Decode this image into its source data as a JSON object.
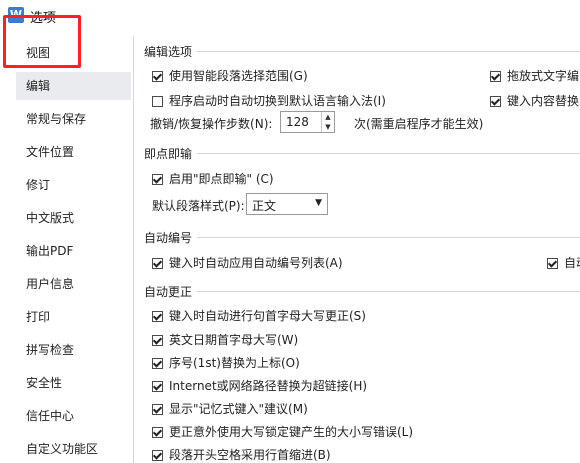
{
  "window": {
    "title": "选项",
    "app_icon": "wps-icon"
  },
  "sidebar": {
    "items": [
      {
        "label": "视图"
      },
      {
        "label": "编辑"
      },
      {
        "label": "常规与保存"
      },
      {
        "label": "文件位置"
      },
      {
        "label": "修订"
      },
      {
        "label": "中文版式"
      },
      {
        "label": "输出PDF"
      },
      {
        "label": "用户信息"
      },
      {
        "label": "打印"
      },
      {
        "label": "拼写检查"
      },
      {
        "label": "安全性"
      },
      {
        "label": "信任中心"
      },
      {
        "label": "自定义功能区"
      }
    ],
    "selected": "编辑"
  },
  "sections": {
    "edit": {
      "title": "编辑选项",
      "smart_para": {
        "label": "使用智能段落选择范围(G)",
        "checked": true
      },
      "auto_ime": {
        "label": "程序启动时自动切换到默认语言输入法(I)",
        "checked": false
      },
      "drag_text": {
        "label": "拖放式文字编",
        "checked": true
      },
      "replace_sel": {
        "label": "键入内容替换",
        "checked": true
      },
      "undo_label": "撤销/恢复操作步数(N):",
      "undo_value": "128",
      "undo_suffix": "次(需重启程序才能生效)"
    },
    "click_type": {
      "title": "即点即输",
      "enable": {
        "label": "启用\"即点即输\" (C)",
        "checked": true
      },
      "style_label": "默认段落样式(P):",
      "style_value": "正文"
    },
    "auto_number": {
      "title": "自动编号",
      "auto_list": {
        "label": "键入时自动应用自动编号列表(A)",
        "checked": true
      },
      "auto_right": {
        "label": "自动",
        "checked": true
      }
    },
    "autocorrect": {
      "title": "自动更正",
      "items": [
        {
          "label": "键入时自动进行句首字母大写更正(S)",
          "checked": true
        },
        {
          "label": "英文日期首字母大写(W)",
          "checked": true
        },
        {
          "label": "序号(1st)替换为上标(O)",
          "checked": true
        },
        {
          "label": "Internet或网络路径替换为超链接(H)",
          "checked": true
        },
        {
          "label": "显示\"记忆式键入\"建议(M)",
          "checked": true
        },
        {
          "label": "更正意外使用大写锁定键产生的大小写错误(L)",
          "checked": true
        },
        {
          "label": "段落开头空格采用行首缩进(B)",
          "checked": true
        }
      ]
    }
  }
}
